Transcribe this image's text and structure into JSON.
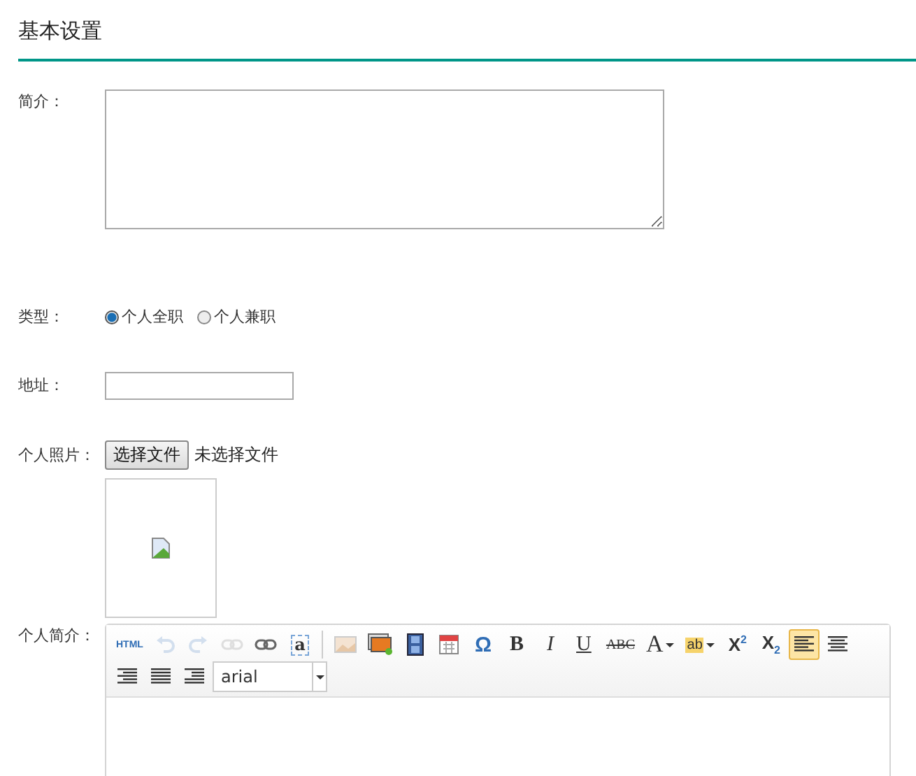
{
  "heading": "基本设置",
  "intro": {
    "label": "简介："
  },
  "type": {
    "label": "类型：",
    "options": [
      {
        "label": "个人全职",
        "selected": true
      },
      {
        "label": "个人兼职",
        "selected": false
      }
    ]
  },
  "address": {
    "label": "地址："
  },
  "photo": {
    "label": "个人照片：",
    "button": "选择文件",
    "status": "未选择文件"
  },
  "profile": {
    "label": "个人简介：",
    "font": "arial",
    "tools": [
      {
        "kind": "html",
        "label": "HTML",
        "disabled": false,
        "selected": false
      },
      {
        "kind": "undo",
        "disabled": true,
        "selected": false
      },
      {
        "kind": "redo",
        "disabled": true,
        "selected": false
      },
      {
        "kind": "unlink",
        "disabled": true,
        "selected": false
      },
      {
        "kind": "link",
        "disabled": false,
        "selected": false
      },
      {
        "kind": "anchor",
        "label": "a",
        "disabled": false,
        "selected": false
      },
      {
        "kind": "sep"
      },
      {
        "kind": "image",
        "disabled": false,
        "selected": false
      },
      {
        "kind": "gallery",
        "disabled": false,
        "selected": false
      },
      {
        "kind": "video",
        "disabled": false,
        "selected": false
      },
      {
        "kind": "calendar",
        "disabled": false,
        "selected": false
      },
      {
        "kind": "char",
        "label": "Ω",
        "disabled": false,
        "selected": false
      },
      {
        "kind": "bold",
        "label": "B",
        "disabled": false,
        "selected": false
      },
      {
        "kind": "italic",
        "label": "I",
        "disabled": false,
        "selected": false
      },
      {
        "kind": "underline",
        "label": "U",
        "disabled": false,
        "selected": false
      },
      {
        "kind": "strike",
        "label": "ABC",
        "disabled": false,
        "selected": false
      },
      {
        "kind": "fontcolor",
        "label": "A",
        "disabled": false,
        "selected": false
      },
      {
        "kind": "highlight",
        "label": "ab",
        "disabled": false,
        "selected": false
      },
      {
        "kind": "script",
        "label": "X$^{2}$",
        "disabled": false,
        "selected": false
      },
      {
        "kind": "script",
        "label": "X$_{2}$",
        "disabled": false,
        "selected": false
      },
      {
        "kind": "align-left",
        "disabled": false,
        "selected": true
      },
      {
        "kind": "align-center",
        "disabled": false,
        "selected": false
      },
      {
        "kind": "align-right",
        "disabled": false,
        "selected": false
      },
      {
        "kind": "justify",
        "disabled": false,
        "selected": false
      },
      {
        "kind": "indent",
        "disabled": false,
        "selected": false
      }
    ]
  }
}
